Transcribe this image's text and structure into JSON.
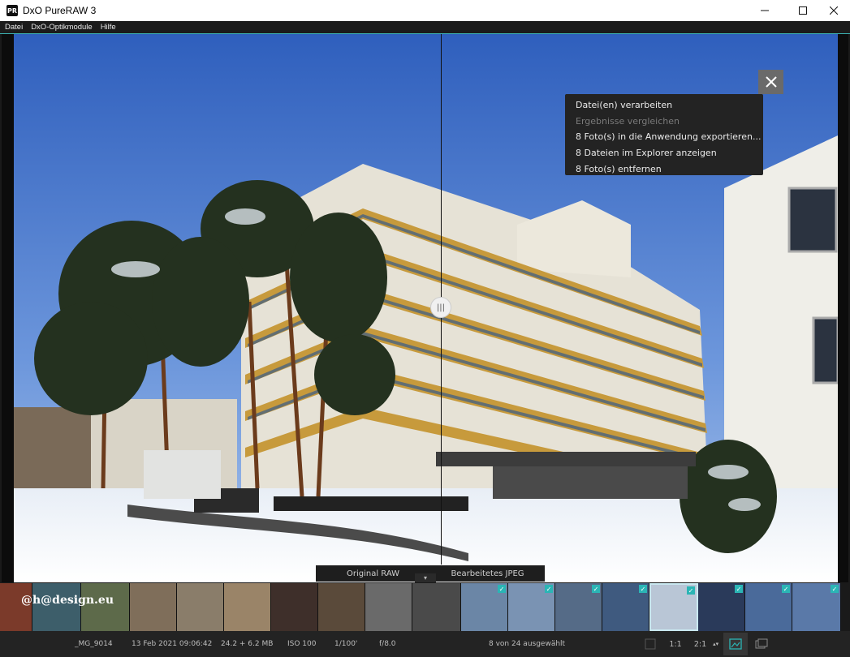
{
  "titlebar": {
    "logo": "PR",
    "title": "DxO PureRAW 3",
    "minimize_icon": "minimize-icon",
    "maximize_icon": "maximize-icon",
    "close_icon": "close-icon"
  },
  "menu": {
    "items": [
      "Datei",
      "DxO-Optikmodule",
      "Hilfe"
    ]
  },
  "viewer": {
    "close_icon": "close-icon",
    "split_handle_icon": "grip-icon"
  },
  "context_menu": {
    "items": [
      {
        "label": "Datei(en) verarbeiten",
        "enabled": true
      },
      {
        "label": "Ergebnisse vergleichen",
        "enabled": false
      },
      {
        "label": " 8 Foto(s) in die Anwendung exportieren...",
        "enabled": true
      },
      {
        "label": "8 Dateien im Explorer anzeigen",
        "enabled": true
      },
      {
        "label": "8 Foto(s) entfernen",
        "enabled": true
      }
    ]
  },
  "compare": {
    "left_label": "Original RAW",
    "right_label": "Bearbeitetes JPEG",
    "chevron_icon": "chevron-down-icon"
  },
  "filmstrip": {
    "watermark": "@h@design.eu",
    "thumbnails": [
      {
        "checked": false
      },
      {
        "checked": false
      },
      {
        "checked": false
      },
      {
        "checked": false
      },
      {
        "checked": false
      },
      {
        "checked": false
      },
      {
        "checked": false
      },
      {
        "checked": false
      },
      {
        "checked": false
      },
      {
        "checked": false
      },
      {
        "checked": true
      },
      {
        "checked": true
      },
      {
        "checked": true
      },
      {
        "checked": true
      },
      {
        "checked": true,
        "selected": true
      },
      {
        "checked": true
      },
      {
        "checked": true
      },
      {
        "checked": true
      }
    ]
  },
  "status": {
    "filename": "_MG_9014",
    "date": "13 Feb 2021 09:06:42",
    "size": "24.2 + 6.2 MB",
    "iso": "ISO 100",
    "shutter": "1/100'",
    "aperture": "f/8.0",
    "selection": "8 von 24 ausgewählt",
    "zoom_fit": "1:1",
    "zoom_level": "2:1",
    "colors": {
      "accent": "#2bb5b5"
    }
  }
}
